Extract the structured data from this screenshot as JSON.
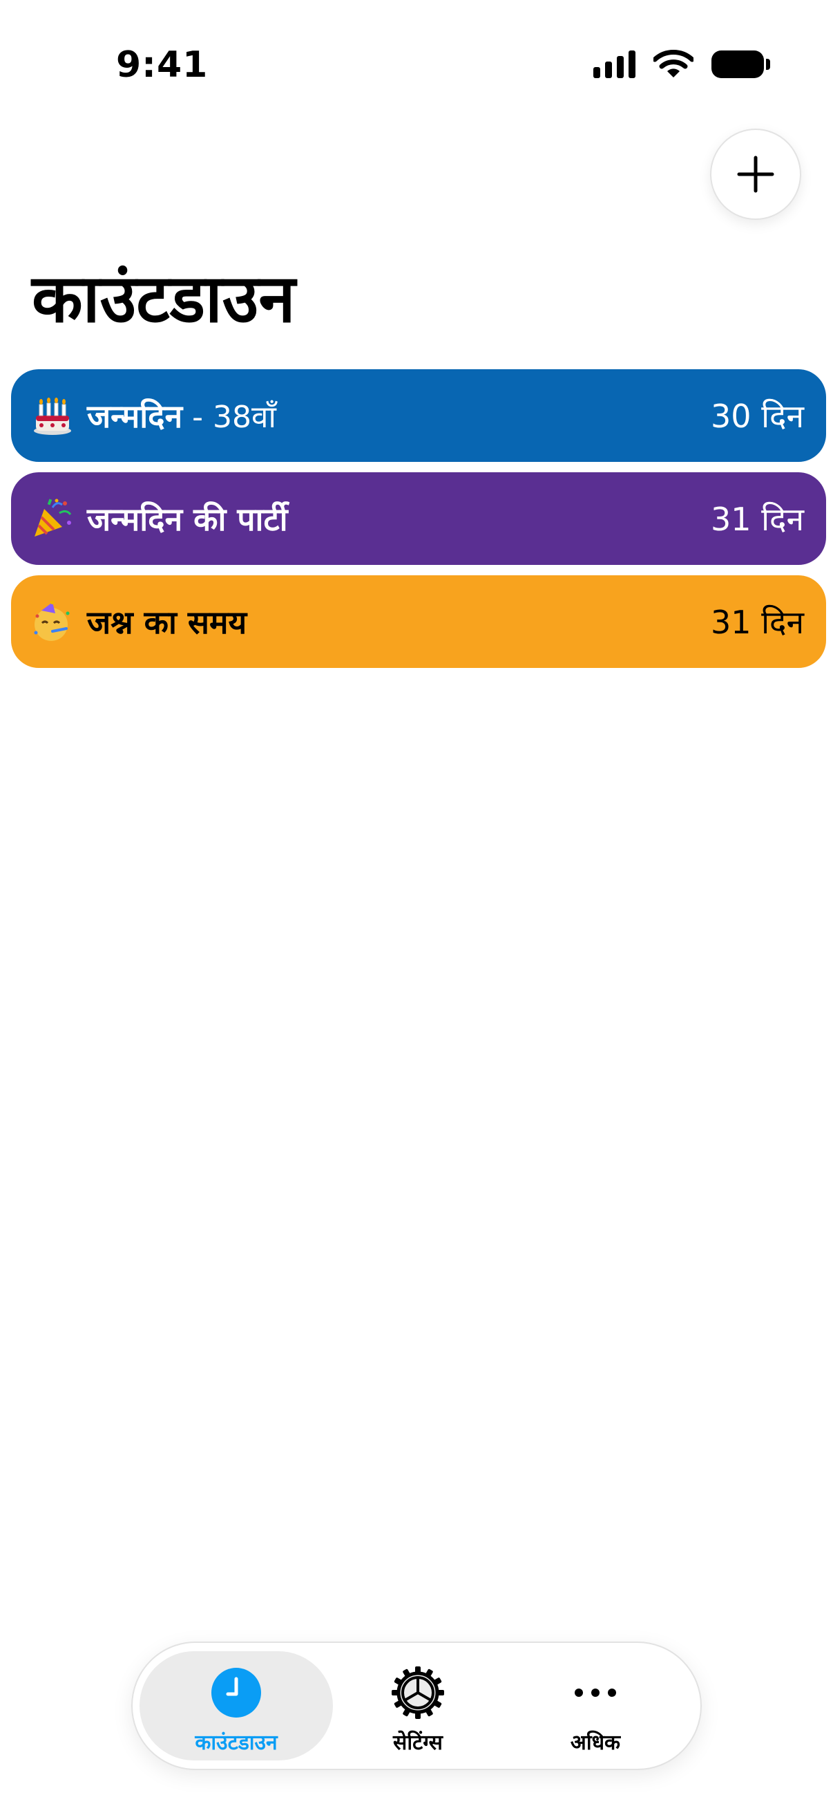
{
  "status_bar": {
    "time": "9:41"
  },
  "header": {
    "title": "काउंटडाउन",
    "add_icon": "plus-icon"
  },
  "countdowns": [
    {
      "emoji": "birthday-cake-emoji",
      "title": "जन्मदिन",
      "subtitle": "- 38वाँ",
      "days": "30 दिन",
      "color": "#0866B2",
      "text_color": "#FFFFFF"
    },
    {
      "emoji": "party-popper-emoji",
      "title": "जन्मदिन की पार्टी",
      "subtitle": "",
      "days": "31 दिन",
      "color": "#5A2F92",
      "text_color": "#FFFFFF"
    },
    {
      "emoji": "partying-face-emoji",
      "title": "जश्न का समय",
      "subtitle": "",
      "days": "31 दिन",
      "color": "#F8A31E",
      "text_color": "#000000"
    }
  ],
  "tab_bar": {
    "tabs": [
      {
        "label": "काउंटडाउन",
        "icon": "clock-icon",
        "active": true
      },
      {
        "label": "सेटिंग्स",
        "icon": "gear-icon",
        "active": false
      },
      {
        "label": "अधिक",
        "icon": "ellipsis-icon",
        "active": false
      }
    ],
    "active_color": "#0A9DF5"
  }
}
